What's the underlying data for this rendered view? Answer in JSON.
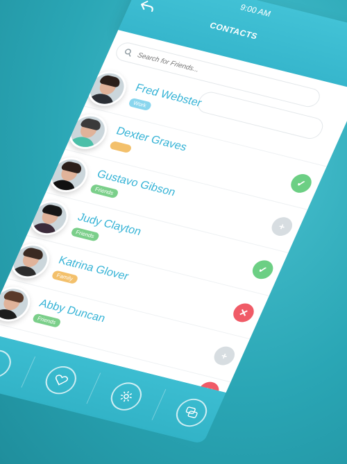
{
  "status": {
    "time": "9:00 AM"
  },
  "header": {
    "title": "CONTACTS"
  },
  "search": {
    "placeholder": "Search for Friends..."
  },
  "contacts": [
    {
      "name": "Fred Webster",
      "tag": "Work",
      "tag_type": "work",
      "action": "none"
    },
    {
      "name": "Dexter Graves",
      "tag": "",
      "tag_type": "empty",
      "action": "check"
    },
    {
      "name": "Gustavo Gibson",
      "tag": "Friends",
      "tag_type": "friends",
      "action": "plus"
    },
    {
      "name": "Judy Clayton",
      "tag": "Friends",
      "tag_type": "friends",
      "action": "check"
    },
    {
      "name": "Katrina Glover",
      "tag": "Family",
      "tag_type": "family",
      "action": "close"
    },
    {
      "name": "Abby Duncan",
      "tag": "Friends",
      "tag_type": "friends",
      "action": "plus"
    }
  ],
  "bottom_nav": {
    "icons": [
      "check-icon",
      "heart-icon",
      "gear-icon",
      "chat-icon"
    ]
  },
  "colors": {
    "accent": "#36b6cc",
    "name_text": "#35b3d6",
    "check": "#6ccf84",
    "plus": "#d7dde1",
    "close": "#f05b67",
    "tag_work": "#8ad6ee",
    "tag_friends": "#7bcf8a",
    "tag_family": "#f3c06b"
  }
}
